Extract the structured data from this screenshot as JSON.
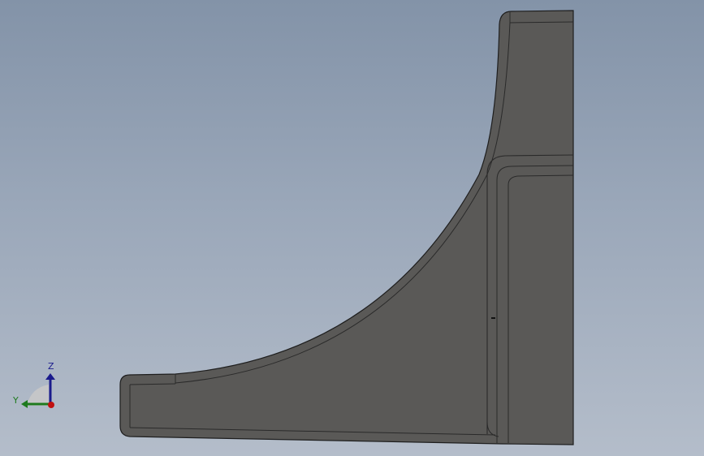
{
  "viewport": {
    "background_top": "#8393a8",
    "background_bottom": "#b4bdca"
  },
  "model": {
    "face_color": "#5a5957",
    "edge_color": "#2a2a2a",
    "silhouette_color": "#1e1e1e"
  },
  "triad": {
    "z_label": "Z",
    "y_label": "Y",
    "z_color": "#1a1a8c",
    "y_color": "#1e7a1e",
    "x_color": "#c01010",
    "plane_color": "#c8c8c8"
  }
}
